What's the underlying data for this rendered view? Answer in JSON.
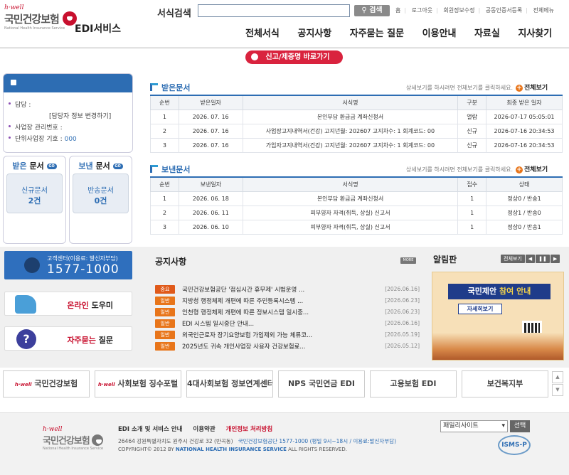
{
  "header": {
    "brand_hwell": "h·well",
    "brand_name": "국민건강보험",
    "brand_sub": "National Health Insurance Service",
    "service_title": "EDI서비스",
    "search_label": "서식검색",
    "search_button": "검색",
    "util_links": [
      "홈",
      "로그아웃",
      "회원정보수정",
      "공동인증서등록",
      "전체메뉴"
    ],
    "nav": [
      "전체서식",
      "공지사항",
      "자주묻는 질문",
      "이용안내",
      "자료실",
      "지사찾기"
    ],
    "report_button": "신고/제증명 바로가기"
  },
  "user_box": {
    "manager_label": "담당 :",
    "change_link": "[담당자 정보 변경하기]",
    "biz_no_label": "사업장 관리번호 :",
    "unit_label": "단위사업장 기호 :",
    "unit_value": "000"
  },
  "received_box": {
    "title_a": "받은",
    "title_b": "문서",
    "go": "GO",
    "new_label": "신규문서",
    "count": "2건"
  },
  "sent_box": {
    "title_a": "보낸",
    "title_b": "문서",
    "go": "GO",
    "new_label": "반송문서",
    "count": "0건"
  },
  "received": {
    "title": "받은문서",
    "hint": "상세보기를 하시려면 전체보기를 클릭하세요.",
    "view_all": "전체보기",
    "headers": [
      "순번",
      "받은일자",
      "서식명",
      "구분",
      "최종 받은 일자"
    ],
    "rows": [
      [
        "1",
        "2026. 07. 16",
        "본인부담 환급금 계좌신청서",
        "열람",
        "2026-07-17 05:05:01"
      ],
      [
        "2",
        "2026. 07. 16",
        "사업장고지내역서(건강) 고지년월: 202607 고지차수: 1 회계코드: 00",
        "신규",
        "2026-07-16 20:34:53"
      ],
      [
        "3",
        "2026. 07. 16",
        "가입자고지내역서(건강) 고지년월: 202607 고지차수: 1 회계코드: 00",
        "신규",
        "2026-07-16 20:34:53"
      ]
    ]
  },
  "sent": {
    "title": "보낸문서",
    "hint": "상세보기를 하시려면 전체보기를 클릭하세요.",
    "view_all": "전체보기",
    "headers": [
      "순번",
      "보낸일자",
      "서식명",
      "접수",
      "상태"
    ],
    "rows": [
      [
        "1",
        "2026. 06. 18",
        "본인부담 환급금 계좌신청서",
        "1",
        "정상0 / 반송1"
      ],
      [
        "2",
        "2026. 06. 11",
        "피부양자 자격(취득, 상실) 신고서",
        "1",
        "정상1 / 반송0"
      ],
      [
        "3",
        "2026. 06. 10",
        "피부양자 자격(취득, 상실) 신고서",
        "1",
        "정상0 / 반송1"
      ]
    ]
  },
  "callcenter": {
    "label": "고객센터(이용료: 발신자부담)",
    "number": "1577-1000"
  },
  "quick_links": [
    {
      "accent": "온라인",
      "rest": " 도우미"
    },
    {
      "accent": "자주묻는",
      "rest": " 질문"
    }
  ],
  "notice": {
    "title": "공지사항",
    "more": "MORE",
    "items": [
      {
        "tag": "중요",
        "title": "국민건강보험공단 '점심시간 휴무제' 시범운영 ...",
        "date": "[2026.06.16]"
      },
      {
        "tag": "일반",
        "title": "지방청 행정체제 개편에 따른 주민등록시스템 ...",
        "date": "[2026.06.23]"
      },
      {
        "tag": "일반",
        "title": "인천형 행정체제 개편에 따른 정보시스템 일시중...",
        "date": "[2026.06.23]"
      },
      {
        "tag": "일반",
        "title": "EDI 시스템 일시중단 안내...",
        "date": "[2026.06.16]"
      },
      {
        "tag": "일반",
        "title": "외국인근로자 장기요양보험 가입제외 가능 체류코...",
        "date": "[2026.05.19]"
      },
      {
        "tag": "일반",
        "title": "2025년도 귀속 개인사업장 사용자 건강보험료...",
        "date": "[2026.05.12]"
      }
    ]
  },
  "alarm": {
    "title": "알림판",
    "view_all": "전체보기",
    "banner_a": "국민제안",
    "banner_b": "참여 안내",
    "banner_btn": "자세히보기"
  },
  "partners": [
    {
      "sub": "h·well",
      "name": "국민건강보험"
    },
    {
      "sub": "h·well",
      "name": "사회보험 징수포털"
    },
    {
      "sub": "",
      "name": "4대사회보험 정보연계센터"
    },
    {
      "sub": "",
      "name": "NPS 국민연금 EDI"
    },
    {
      "sub": "",
      "name": "고용보험 EDI"
    },
    {
      "sub": "",
      "name": "보건복지부"
    }
  ],
  "footer": {
    "links": [
      "EDI 소개 및 서비스 안내",
      "이용약관",
      "개인정보 처리방침"
    ],
    "address": "26464 강원특별자치도 원주시 건강로 32 (반곡동)",
    "address_hl": "국민건강보험공단 1577-1000 (평일 9시~18시 / 이용료:발신자부담)",
    "copy_a": "COPYRIGHT© 2012 BY",
    "copy_hl": "NATIONAL HEALTH INSURANCE SERVICE",
    "copy_b": "ALL RIGHTS RESERVED.",
    "family_select": "패밀리사이트",
    "family_btn": "선택",
    "isms": "ISMS-P"
  },
  "colors": {
    "brand_red": "#c8102e",
    "primary_blue": "#2d6db3",
    "tag_orange": "#e8751a"
  }
}
